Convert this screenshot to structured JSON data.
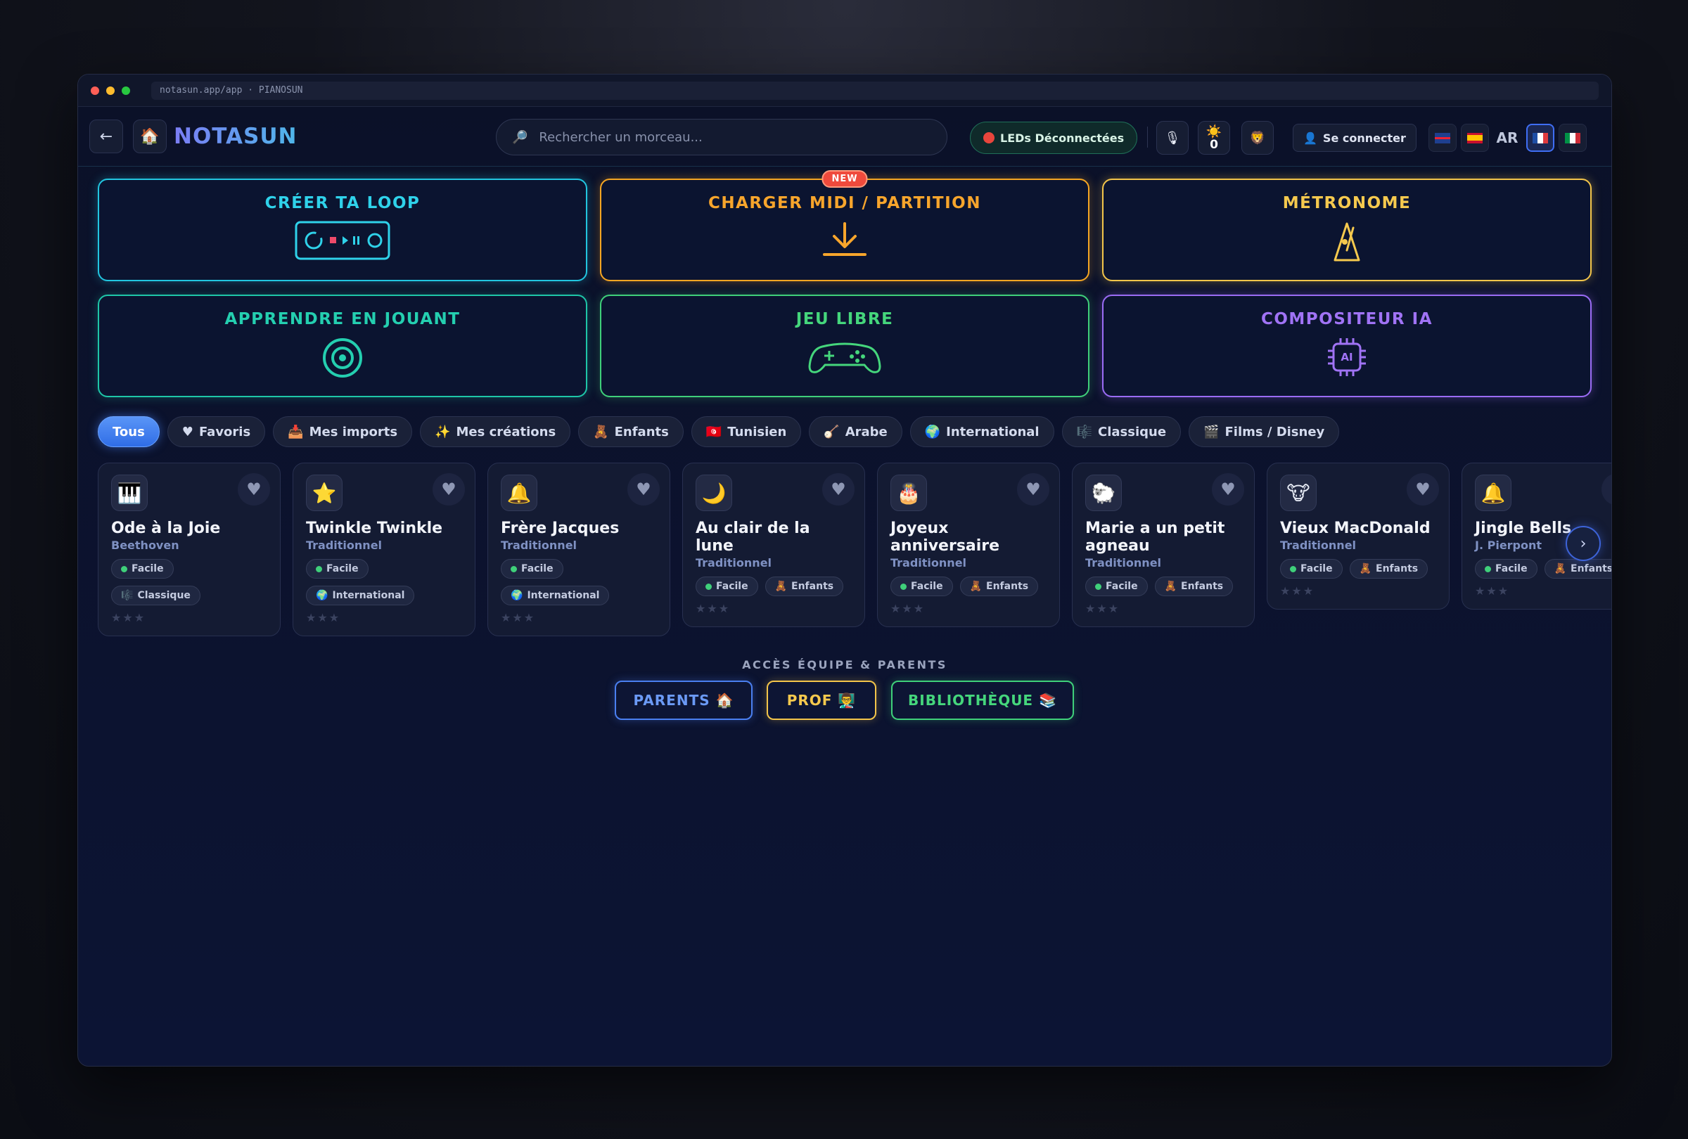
{
  "browser": {
    "url": "notasun.app/app · PIANOSUN"
  },
  "header": {
    "logo": "NOTASUN",
    "search_placeholder": "Rechercher un morceau...",
    "leds_status": "LEDs Déconnectées",
    "score": "0",
    "login_label": "Se connecter",
    "lang_ar": "AR"
  },
  "tiles": {
    "loop": "CRÉER TA LOOP",
    "midi": "CHARGER MIDI / PARTITION",
    "midi_badge": "NEW",
    "metronome": "MÉTRONOME",
    "learn": "APPRENDRE EN JOUANT",
    "free": "JEU LIBRE",
    "ai": "COMPOSITEUR IA",
    "ai_chip_text": "AI"
  },
  "filters": [
    {
      "icon": "",
      "label": "Tous"
    },
    {
      "icon": "♥",
      "label": "Favoris"
    },
    {
      "icon": "📥",
      "label": "Mes imports"
    },
    {
      "icon": "✨",
      "label": "Mes créations"
    },
    {
      "icon": "🧸",
      "label": "Enfants"
    },
    {
      "icon": "🇹🇳",
      "label": "Tunisien"
    },
    {
      "icon": "🪕",
      "label": "Arabe"
    },
    {
      "icon": "🌍",
      "label": "International"
    },
    {
      "icon": "🎼",
      "label": "Classique"
    },
    {
      "icon": "🎬",
      "label": "Films / Disney"
    }
  ],
  "songs": [
    {
      "icon": "🎹",
      "title": "Ode à la Joie",
      "artist": "Beethoven",
      "level": "Facile",
      "tag_icon": "🎼",
      "tag": "Classique"
    },
    {
      "icon": "⭐",
      "title": "Twinkle Twinkle",
      "artist": "Traditionnel",
      "level": "Facile",
      "tag_icon": "🌍",
      "tag": "International"
    },
    {
      "icon": "🔔",
      "title": "Frère Jacques",
      "artist": "Traditionnel",
      "level": "Facile",
      "tag_icon": "🌍",
      "tag": "International"
    },
    {
      "icon": "🌙",
      "title": "Au clair de la lune",
      "artist": "Traditionnel",
      "level": "Facile",
      "tag_icon": "🧸",
      "tag": "Enfants"
    },
    {
      "icon": "🎂",
      "title": "Joyeux anniversaire",
      "artist": "Traditionnel",
      "level": "Facile",
      "tag_icon": "🧸",
      "tag": "Enfants"
    },
    {
      "icon": "🐑",
      "title": "Marie a un petit agneau",
      "artist": "Traditionnel",
      "level": "Facile",
      "tag_icon": "🧸",
      "tag": "Enfants"
    },
    {
      "icon": "🐮",
      "title": "Vieux MacDonald",
      "artist": "Traditionnel",
      "level": "Facile",
      "tag_icon": "🧸",
      "tag": "Enfants"
    },
    {
      "icon": "🔔",
      "title": "Jingle Bells",
      "artist": "J. Pierpont",
      "level": "Facile",
      "tag_icon": "🧸",
      "tag": "Enfants"
    }
  ],
  "stars": "★★★",
  "access": {
    "title": "ACCÈS ÉQUIPE & PARENTS",
    "parents": "PARENTS 🏠",
    "prof": "PROF 👨‍🏫",
    "library": "BIBLIOTHÈQUE 📚"
  },
  "colors": {
    "cyan": "#22c6e0",
    "orange": "#f5a623",
    "yellow": "#f3c54a",
    "teal": "#1ec6a8",
    "green": "#3fd07a",
    "purple": "#9b6cf5",
    "blue": "#3f6ef5"
  }
}
